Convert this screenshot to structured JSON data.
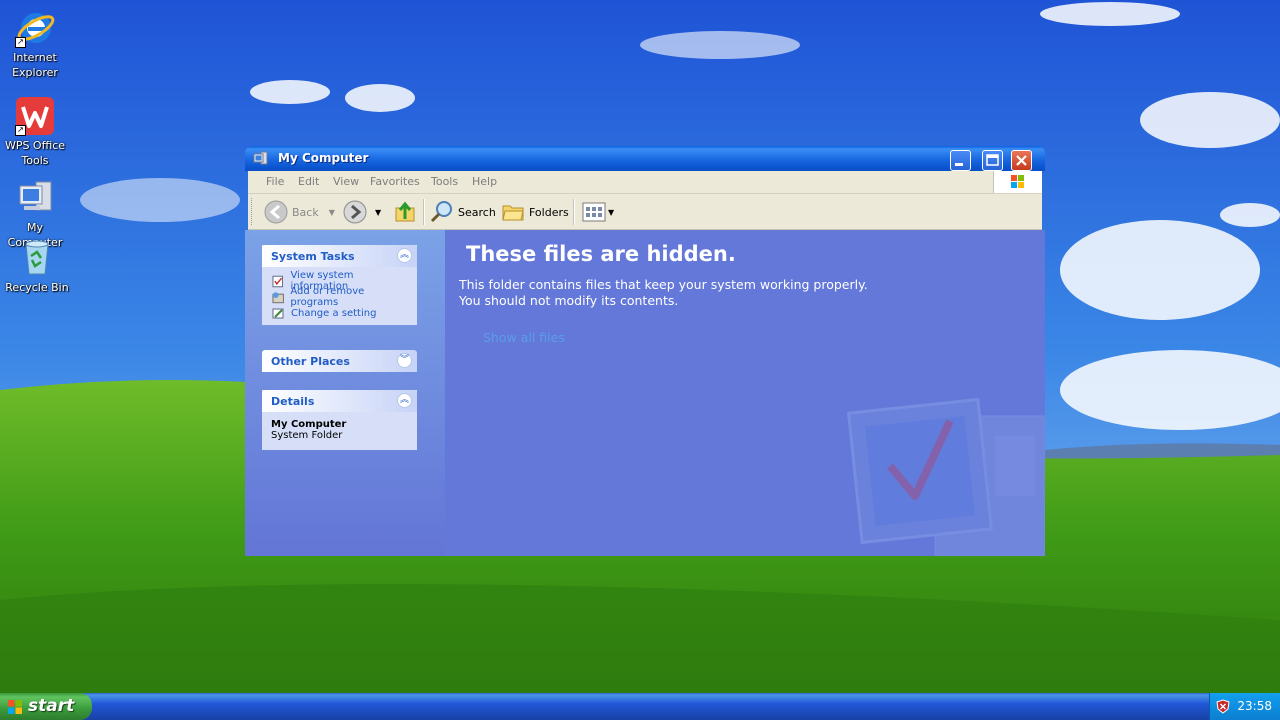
{
  "desktop": {
    "icons": [
      {
        "label_line1": "Internet",
        "label_line2": "Explorer",
        "icon": "internet-explorer-icon"
      },
      {
        "label_line1": "WPS Office",
        "label_line2": "Tools",
        "icon": "wps-office-icon"
      },
      {
        "label_line1": "My Computer",
        "label_line2": "",
        "icon": "my-computer-icon"
      },
      {
        "label_line1": "Recycle Bin",
        "label_line2": "",
        "icon": "recycle-bin-icon"
      }
    ]
  },
  "window": {
    "title": "My Computer",
    "menu": [
      "File",
      "Edit",
      "View",
      "Favorites",
      "Tools",
      "Help"
    ],
    "toolbar": {
      "back_label": "Back",
      "search_label": "Search",
      "folders_label": "Folders"
    },
    "left_pane": {
      "system_tasks": {
        "heading": "System Tasks",
        "links": [
          "View system information",
          "Add or remove programs",
          "Change a setting"
        ]
      },
      "other_places": {
        "heading": "Other Places"
      },
      "details": {
        "heading": "Details",
        "name": "My Computer",
        "type": "System Folder"
      }
    },
    "content": {
      "headline": "These files are hidden.",
      "message_line1": "This folder contains files that keep your system working properly.",
      "message_line2": "You should not modify its contents.",
      "show_all_link": "Show all files"
    }
  },
  "taskbar": {
    "start_label": "start",
    "clock": "23:58"
  },
  "colors": {
    "title_bar": "#1f6fe6",
    "task_pane": "#7ba2e7",
    "content_bg": "#6378d8",
    "start_button": "#3a9a3a",
    "tray": "#0f8ee0"
  }
}
